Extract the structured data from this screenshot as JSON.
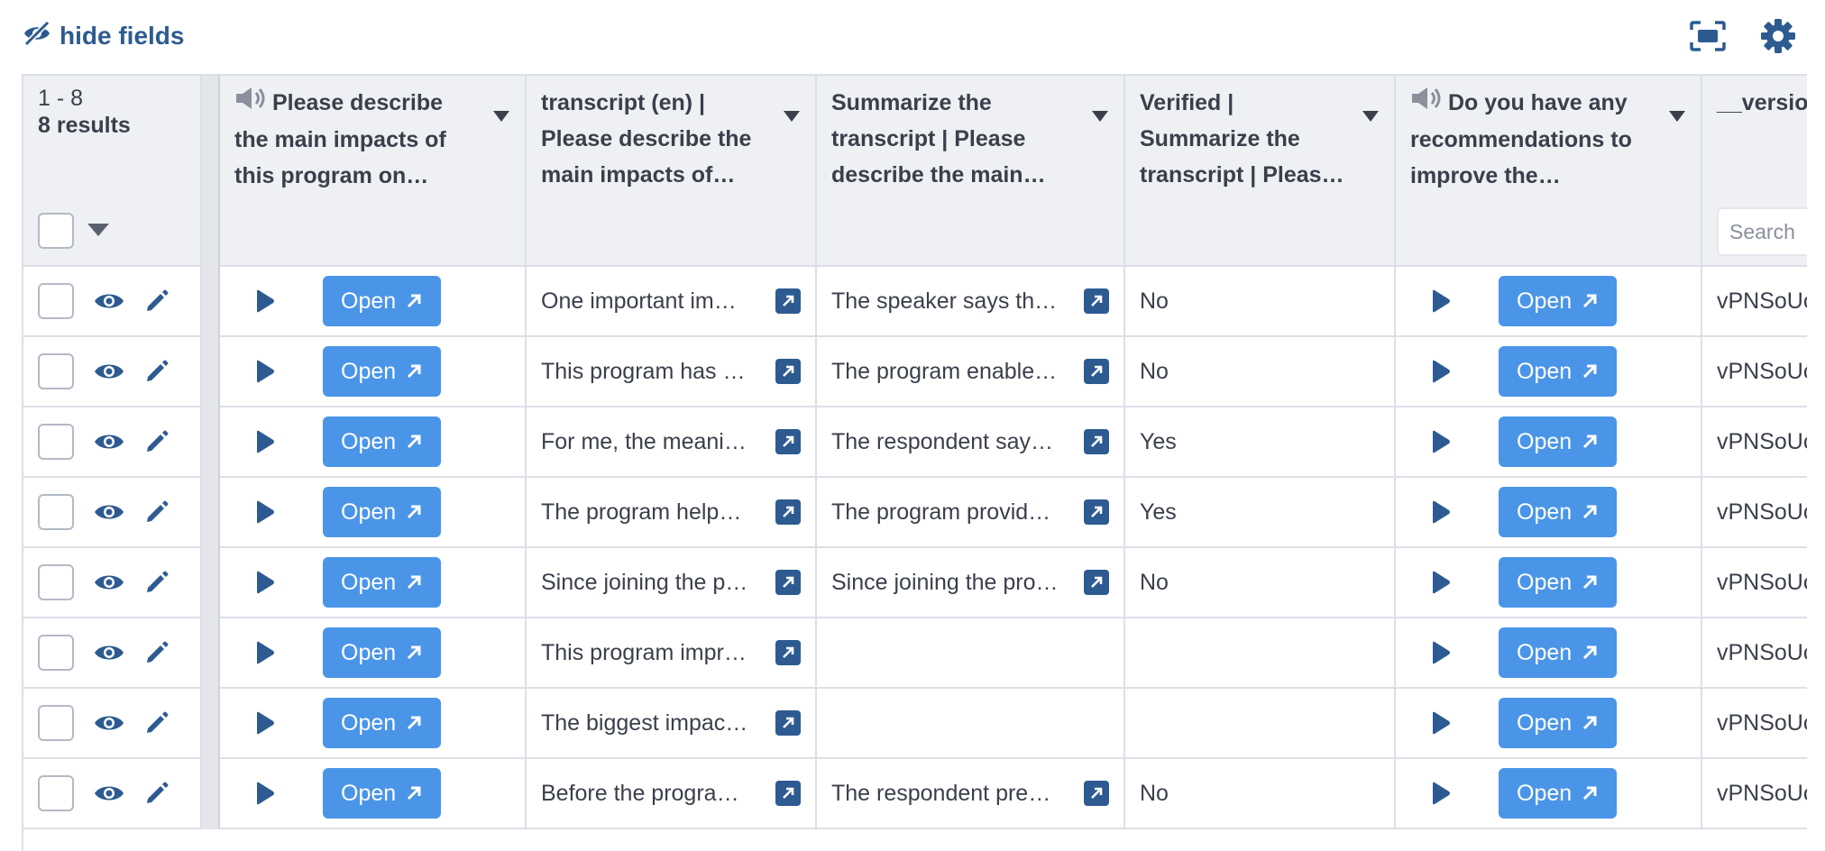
{
  "toolbar": {
    "hide_fields_label": "hide fields"
  },
  "header": {
    "range": "1 - 8",
    "count": "8 results",
    "columns": [
      "Please describe the main impacts of this program on your…",
      "transcript (en) | Please describe the main impacts of thi…",
      "Summarize the transcript | Please describe the main…",
      "Verified | Summarize the transcript | Pleas…",
      "Do you have any recommendations to improve the program…",
      "__version__"
    ],
    "search_placeholder": "Search"
  },
  "open_label": "Open",
  "rows": [
    {
      "transcript": "One important im…",
      "summary": "The speaker says th…",
      "verified": "No",
      "version": "vPNSoUc"
    },
    {
      "transcript": "This program has …",
      "summary": "The program enable…",
      "verified": "No",
      "version": "vPNSoUc"
    },
    {
      "transcript": "For me, the meani…",
      "summary": "The respondent say…",
      "verified": "Yes",
      "version": "vPNSoUc"
    },
    {
      "transcript": "The program help…",
      "summary": "The program provid…",
      "verified": "Yes",
      "version": "vPNSoUc"
    },
    {
      "transcript": "Since joining the p…",
      "summary": "Since joining the pro…",
      "verified": "No",
      "version": "vPNSoUc"
    },
    {
      "transcript": "This program impr…",
      "summary": "",
      "verified": "",
      "version": "vPNSoUc"
    },
    {
      "transcript": "The biggest impac…",
      "summary": "",
      "verified": "",
      "version": "vPNSoUc"
    },
    {
      "transcript": "Before the progra…",
      "summary": "The respondent pre…",
      "verified": "No",
      "version": "vPNSoUc"
    }
  ],
  "colors": {
    "accent": "#4a95e8",
    "dark_blue": "#2d5b91",
    "header_bg": "#eef0f4",
    "border": "#dcdfe6"
  },
  "icons": [
    "eye-slash-icon",
    "fullscreen-icon",
    "gear-icon",
    "speaker-icon",
    "caret-down-icon",
    "eye-icon",
    "pencil-icon",
    "play-icon",
    "external-link-icon"
  ]
}
